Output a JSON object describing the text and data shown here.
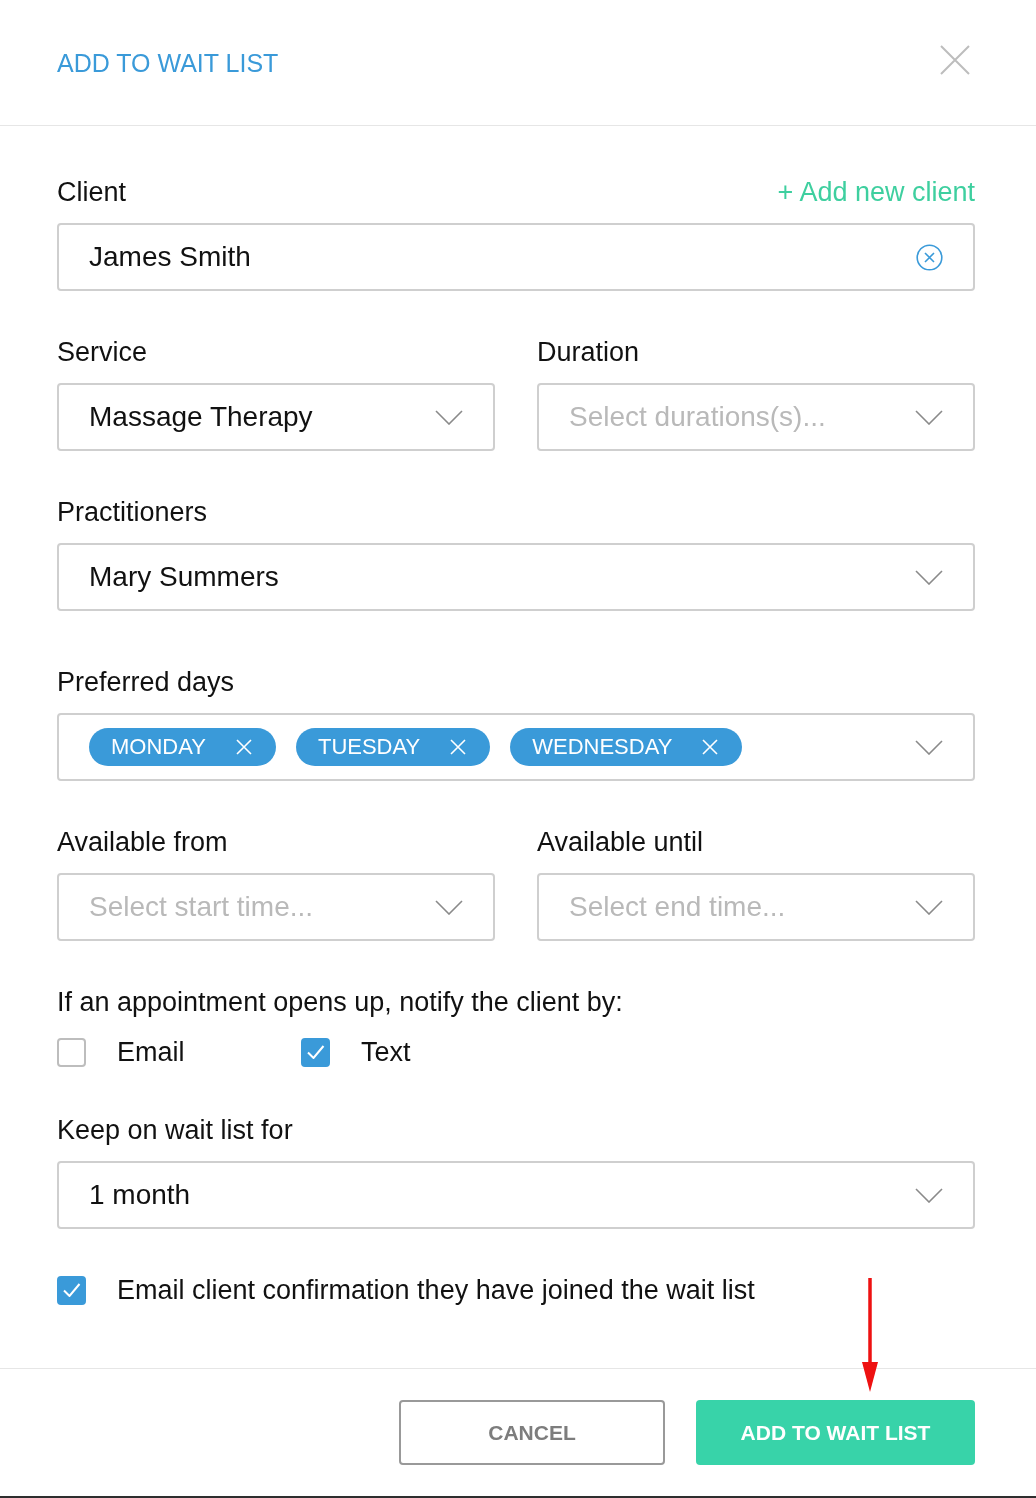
{
  "dialog": {
    "title": "ADD TO WAIT LIST"
  },
  "client": {
    "label": "Client",
    "add_link": "+ Add new client",
    "value": "James Smith"
  },
  "service": {
    "label": "Service",
    "value": "Massage Therapy"
  },
  "duration": {
    "label": "Duration",
    "placeholder": "Select durations(s)..."
  },
  "practitioners": {
    "label": "Practitioners",
    "value": "Mary Summers"
  },
  "preferred_days": {
    "label": "Preferred days",
    "chips": [
      "MONDAY",
      "TUESDAY",
      "WEDNESDAY"
    ]
  },
  "available_from": {
    "label": "Available from",
    "placeholder": "Select start time..."
  },
  "available_until": {
    "label": "Available until",
    "placeholder": "Select end time..."
  },
  "notify": {
    "label": "If an appointment opens up, notify the client by:",
    "options": [
      {
        "label": "Email",
        "checked": false
      },
      {
        "label": "Text",
        "checked": true
      }
    ]
  },
  "keep_on_list": {
    "label": "Keep on wait list for",
    "value": "1 month"
  },
  "confirmation": {
    "label": "Email client confirmation they have joined the wait list",
    "checked": true
  },
  "buttons": [
    {
      "label": "CANCEL",
      "kind": "secondary"
    },
    {
      "label": "ADD TO WAIT LIST",
      "kind": "primary"
    }
  ]
}
